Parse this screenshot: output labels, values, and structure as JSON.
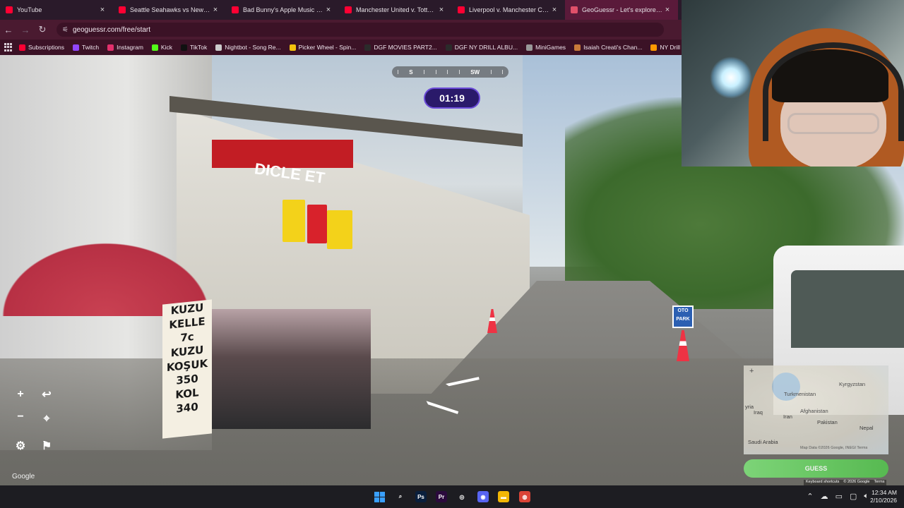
{
  "browser": {
    "tabs": [
      {
        "title": "YouTube",
        "color": "#ff0033",
        "active": false
      },
      {
        "title": "Seattle Seahawks vs New Engla",
        "color": "#ff0033",
        "active": false
      },
      {
        "title": "Bad Bunny's Apple Music Supe",
        "color": "#ff0033",
        "active": false
      },
      {
        "title": "Manchester United v. Tottenha",
        "color": "#ff0033",
        "active": false
      },
      {
        "title": "Liverpool v. Manchester City | P",
        "color": "#ff0033",
        "active": false
      },
      {
        "title": "GeoGuessr - Let's explore the w",
        "color": "#e0506a",
        "active": true
      }
    ],
    "close_glyph": "×",
    "url": "geoguessr.com/free/start",
    "bookmarks": [
      {
        "label": "Subscriptions",
        "color": "#ff0033"
      },
      {
        "label": "Twitch",
        "color": "#9146ff"
      },
      {
        "label": "Instagram",
        "color": "#e1306c"
      },
      {
        "label": "Kick",
        "color": "#53fc18"
      },
      {
        "label": "TikTok",
        "color": "#111111"
      },
      {
        "label": "Nightbot - Song Re...",
        "color": "#cccccc"
      },
      {
        "label": "Picker Wheel - Spin...",
        "color": "#f4c20d"
      },
      {
        "label": "DGF MOVIES PART2...",
        "color": "#2b2b2b"
      },
      {
        "label": "DGF NY DRILL ALBU...",
        "color": "#2b2b2b"
      },
      {
        "label": "MiniGames",
        "color": "#999999"
      },
      {
        "label": "Isaiah Creati's Chan...",
        "color": "#c97b3a"
      },
      {
        "label": "NY Drill Deads Qu",
        "color": "#ff9900"
      }
    ]
  },
  "scene": {
    "shop_sign": "DICLE ET",
    "price_sign_lines": [
      "KUZU",
      "KELLE",
      "7c",
      "KUZU",
      "KOŞUK",
      "350",
      "KOL",
      "340"
    ],
    "otopark": "OTO PARK"
  },
  "game": {
    "compass": {
      "left": "S",
      "right": "SW"
    },
    "timer": "01:19",
    "controls": {
      "zoom_in": "+",
      "zoom_out": "−",
      "undo": "↩",
      "checkpoint": "⌖",
      "settings": "⚙",
      "flag": "⚑"
    },
    "google_mark": "Google",
    "minimap": {
      "plus": "+",
      "labels": [
        "Kyrgyzstan",
        "Turkmenistan",
        "Afghanistan",
        "Iran",
        "Iraq",
        "yria",
        "Pakistan",
        "Nepal",
        "Saudi Arabia"
      ],
      "credit": "Map Data ©2026 Google, INEGI   Terms"
    },
    "guess_button": "GUESS",
    "footer": [
      "Keyboard shortcuts",
      "© 2026 Google",
      "Terms"
    ]
  },
  "taskbar": {
    "apps": [
      {
        "name": "search",
        "glyph": "⌕",
        "color": "#1d1d22"
      },
      {
        "name": "photoshop",
        "glyph": "Ps",
        "color": "#0a1f3c"
      },
      {
        "name": "premiere",
        "glyph": "Pr",
        "color": "#2a0a3c"
      },
      {
        "name": "chatgpt",
        "glyph": "◎",
        "color": "#1d1d22"
      },
      {
        "name": "discord",
        "glyph": "◉",
        "color": "#5865f2"
      },
      {
        "name": "explorer",
        "glyph": "▬",
        "color": "#f2b705"
      },
      {
        "name": "chrome",
        "glyph": "◍",
        "color": "#db4437"
      }
    ],
    "time": "12:34 AM",
    "date": "2/10/2026"
  }
}
